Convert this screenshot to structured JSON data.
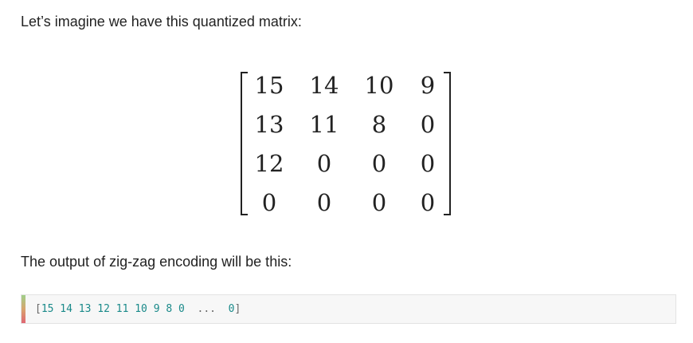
{
  "intro_text": "Let’s imagine we have this quantized matrix:",
  "matrix": [
    [
      "15",
      "14",
      "10",
      "9"
    ],
    [
      "13",
      "11",
      "8",
      "0"
    ],
    [
      "12",
      "0",
      "0",
      "0"
    ],
    [
      "0",
      "0",
      "0",
      "0"
    ]
  ],
  "output_text": "The output of zig-zag encoding will be this:",
  "code": {
    "open": "[",
    "numbers": "15 14 13 12 11 10 9 8 0",
    "ellipsis": "...",
    "last": "0",
    "close": "]",
    "colors": {
      "number": "#1a8a8a",
      "punctuation": "#666666",
      "accent_top": "#9fcf89",
      "accent_bottom": "#e06673"
    }
  }
}
